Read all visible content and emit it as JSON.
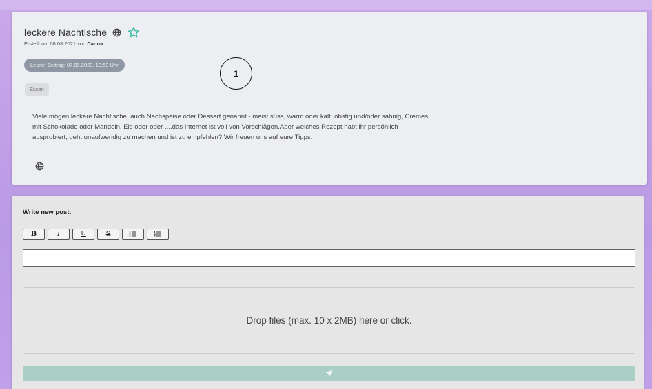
{
  "thread": {
    "title": "leckere Nachtische",
    "meta_prefix": "Erstellt am 08.08.2021 von",
    "author": "Canna",
    "last_post": "Letzter Beitrag: 07.09.2023, 10:53 Uhr",
    "tag": "Essen",
    "description": "Viele mögen leckere Nachtische, auch Nachspeise oder Dessert genannt - meist süss, warm oder kalt, obstig und/oder sahnig, Cremes mit Schokolade oder Mandeln, Eis oder oder ....das Internet ist voll von Vorschlägen.Aber welches Rezept habt ihr persönlich ausprobiert, geht unaufwendig zu machen und ist zu empfehlen? Wir freuen uns auf eure Tipps.",
    "marker": "1",
    "icons": {
      "visibility": "globe-icon",
      "favorite": "star-outline-icon"
    },
    "colors": {
      "star": "#2bb7a0",
      "badge": "#8e97a3"
    }
  },
  "editor": {
    "label": "Write new post:",
    "toolbar": [
      {
        "name": "bold-button",
        "label": "B"
      },
      {
        "name": "italic-button",
        "label": "I"
      },
      {
        "name": "underline-button",
        "label": "U"
      },
      {
        "name": "strikethrough-button",
        "label": "S"
      },
      {
        "name": "bullet-list-button",
        "icon": "bullet-list-icon"
      },
      {
        "name": "numbered-list-button",
        "icon": "numbered-list-icon"
      }
    ],
    "input_value": "",
    "dropzone_text": "Drop files (max. 10 x 2MB) here or click.",
    "send_icon": "paper-plane-icon",
    "colors": {
      "send": "#a9cfc6"
    }
  }
}
